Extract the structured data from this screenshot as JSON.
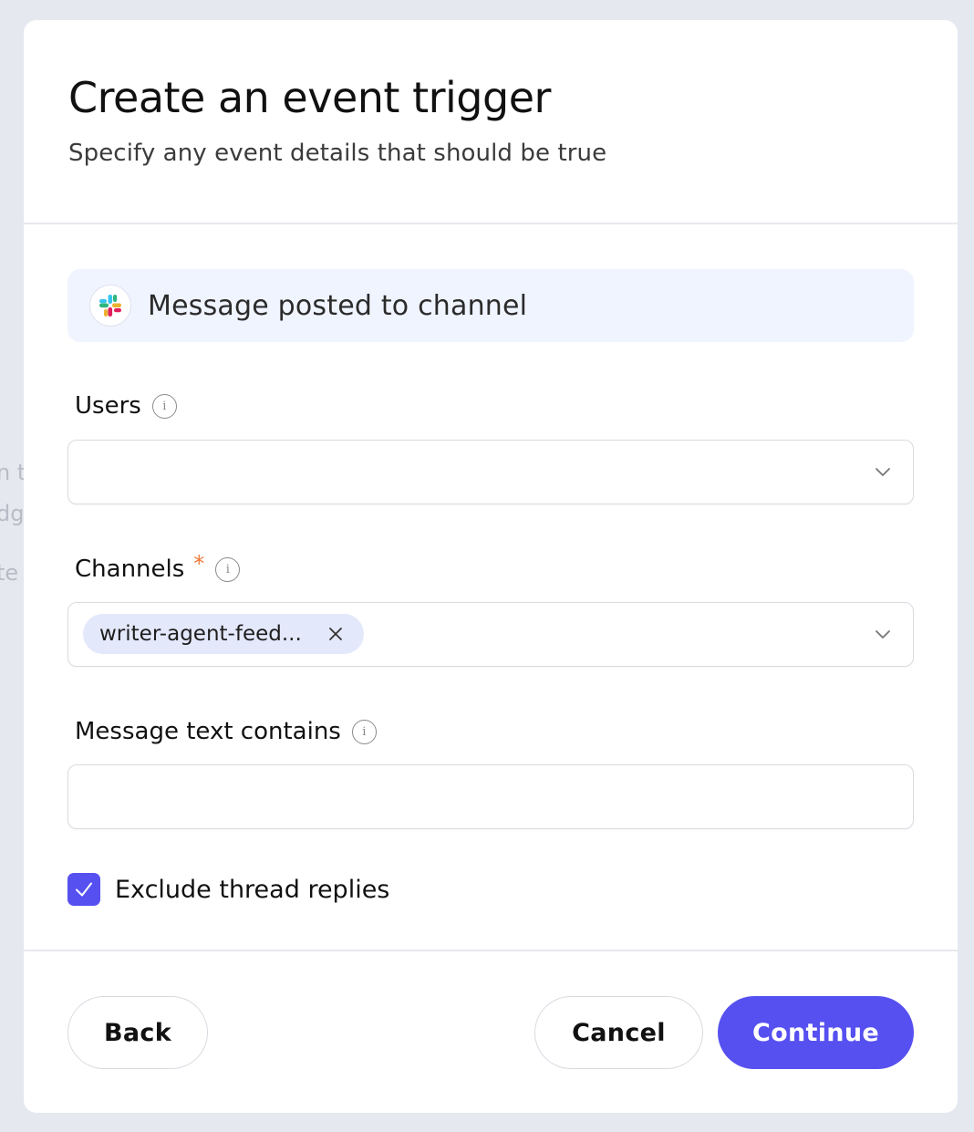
{
  "background": {
    "fragments": [
      "n t",
      "dg",
      "te"
    ]
  },
  "modal": {
    "title": "Create an event trigger",
    "subtitle": "Specify any event details that should be true"
  },
  "event": {
    "icon": "slack-icon",
    "label": "Message posted to channel"
  },
  "fields": {
    "users": {
      "label": "Users",
      "value": ""
    },
    "channels": {
      "label": "Channels",
      "required_mark": "*",
      "chips": [
        "writer-agent-feed..."
      ]
    },
    "message_text": {
      "label": "Message text contains",
      "value": ""
    }
  },
  "options": {
    "exclude_thread_replies": {
      "label": "Exclude thread replies",
      "checked": true
    }
  },
  "buttons": {
    "back": "Back",
    "cancel": "Cancel",
    "continue": "Continue"
  },
  "colors": {
    "primary": "#5650f0",
    "event_card_bg": "#f0f4ff",
    "chip_bg": "#e4e8fb",
    "required": "#f07a3a"
  }
}
